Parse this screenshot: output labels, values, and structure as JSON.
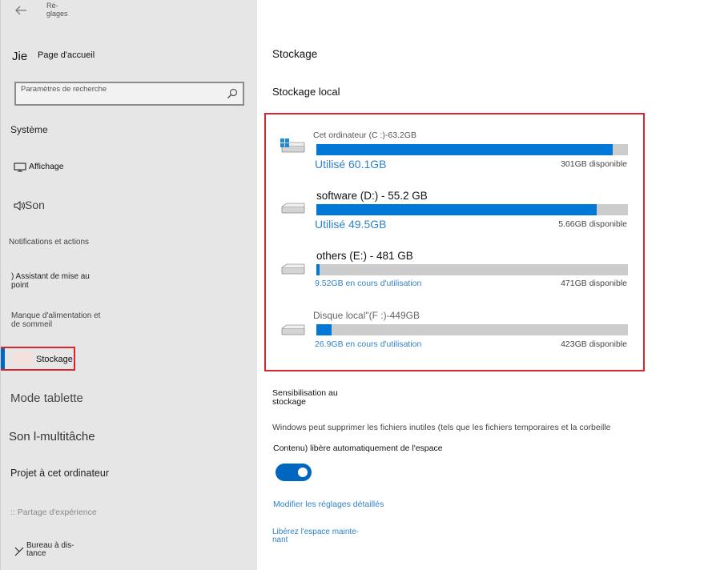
{
  "window": {
    "title": "Ré-\nglages",
    "back_glyph": "←"
  },
  "sidebar": {
    "home_icon_text": "Jie",
    "home_label": "Page d'accueil",
    "search_placeholder": "Paramètres de recherche",
    "group_label": "Système",
    "items": [
      {
        "label": "Affichage"
      },
      {
        "label": "Son"
      },
      {
        "label": "Notifications et actions"
      },
      {
        "label": ") Assistant de mise au point"
      },
      {
        "label": "Manque d'alimentation et de sommeil"
      },
      {
        "label": "Stockage"
      },
      {
        "label": "Mode tablette"
      },
      {
        "label": "Son l-multitâche"
      },
      {
        "label": "Projet à cet ordinateur"
      },
      {
        "label": ":: Partage d'expérience"
      },
      {
        "label": "Bureau à dis-\ntance"
      }
    ],
    "active_item": "Stockage"
  },
  "main": {
    "title": "Stockage",
    "section_title": "Stockage local",
    "drives": [
      {
        "name": "Cet ordinateur (C :)-63.2GB",
        "used_label": "Utilisé 60.1GB",
        "available_label": "301GB disponible",
        "used_fraction": 0.95
      },
      {
        "name": "software (D:) - 55.2 GB",
        "used_label": "Utilisé 49.5GB",
        "available_label": "5.66GB disponible",
        "used_fraction": 0.9
      },
      {
        "name": "others (E:) - 481 GB",
        "used_label": "9.52GB en cours d'utilisation",
        "available_label": "471GB disponible",
        "used_fraction": 0.01
      },
      {
        "name": "Disque local\"(F :)-449GB",
        "used_label": "26.9GB en cours d'utilisation",
        "available_label": "423GB disponible",
        "used_fraction": 0.05
      }
    ],
    "sense": {
      "title": "Sensibilisation au stockage",
      "description": "Windows peut supprimer les fichiers inutiles (tels que les fichiers temporaires et la corbeille",
      "description2": "Contenu) libère automatiquement de l'espace",
      "toggle_on": true
    },
    "links": {
      "modify": "Modifier les réglages détaillés",
      "free_space": "Libérez l'espace mainte-\nnant"
    }
  },
  "colors": {
    "accent": "#0078d7",
    "highlight_border": "#d9262c",
    "sidebar_bg": "#e6e6e6",
    "link": "#2f83c8"
  }
}
